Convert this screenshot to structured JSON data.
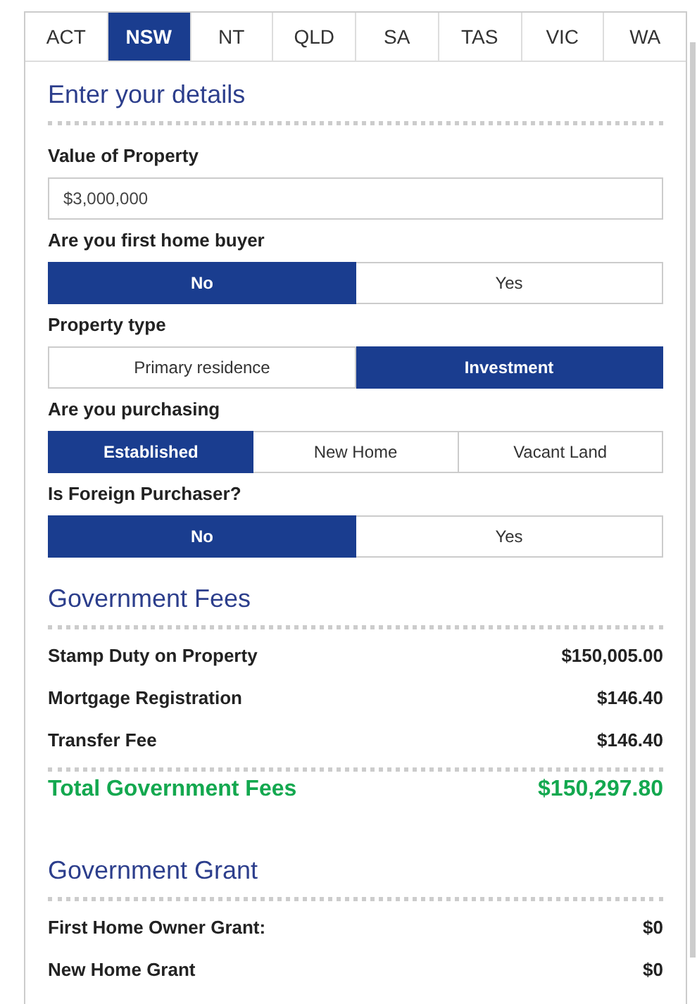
{
  "tabs": [
    {
      "label": "ACT",
      "selected": false
    },
    {
      "label": "NSW",
      "selected": true
    },
    {
      "label": "NT",
      "selected": false
    },
    {
      "label": "QLD",
      "selected": false
    },
    {
      "label": "SA",
      "selected": false
    },
    {
      "label": "TAS",
      "selected": false
    },
    {
      "label": "VIC",
      "selected": false
    },
    {
      "label": "WA",
      "selected": false
    }
  ],
  "details": {
    "heading": "Enter your details",
    "fields": [
      {
        "kind": "text",
        "label": "Value of Property",
        "value": "$3,000,000"
      },
      {
        "kind": "toggle",
        "label": "Are you first home buyer",
        "options": [
          {
            "label": "No",
            "selected": true
          },
          {
            "label": "Yes",
            "selected": false
          }
        ]
      },
      {
        "kind": "toggle",
        "label": "Property type",
        "options": [
          {
            "label": "Primary residence",
            "selected": false
          },
          {
            "label": "Investment",
            "selected": true
          }
        ]
      },
      {
        "kind": "toggle",
        "label": "Are you purchasing",
        "options": [
          {
            "label": "Established",
            "selected": true
          },
          {
            "label": "New Home",
            "selected": false
          },
          {
            "label": "Vacant Land",
            "selected": false
          }
        ]
      },
      {
        "kind": "toggle",
        "label": "Is Foreign Purchaser?",
        "options": [
          {
            "label": "No",
            "selected": true
          },
          {
            "label": "Yes",
            "selected": false
          }
        ]
      }
    ]
  },
  "fees": {
    "heading": "Government Fees",
    "rows": [
      {
        "label": "Stamp Duty on Property",
        "value": "$150,005.00"
      },
      {
        "label": "Mortgage Registration",
        "value": "$146.40"
      },
      {
        "label": "Transfer Fee",
        "value": "$146.40"
      }
    ],
    "total": {
      "label": "Total Government Fees",
      "value": "$150,297.80"
    }
  },
  "grant": {
    "heading": "Government Grant",
    "rows": [
      {
        "label": "First Home Owner Grant:",
        "value": "$0"
      },
      {
        "label": "New Home Grant",
        "value": "$0"
      }
    ]
  }
}
